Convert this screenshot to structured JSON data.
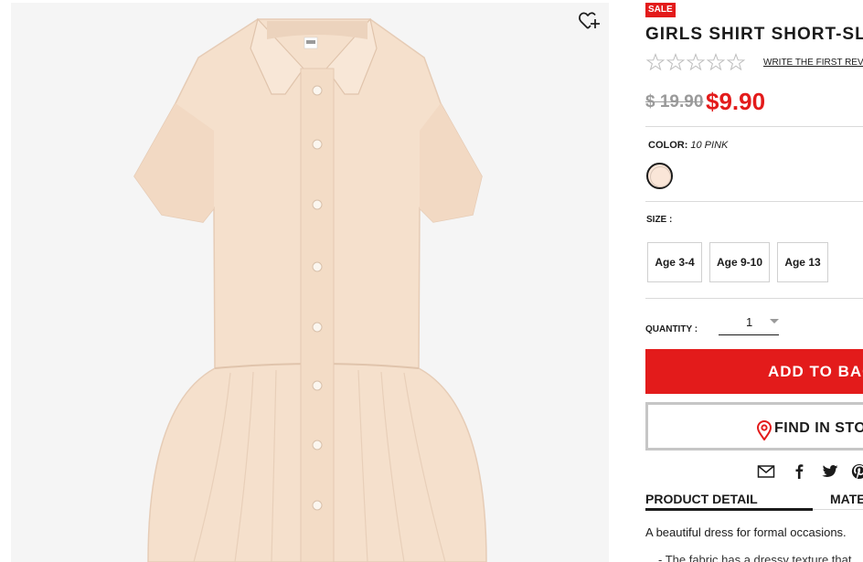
{
  "product": {
    "sale_badge": "SALE",
    "title": "GIRLS SHIRT SHORT-SLE",
    "review_link": "WRITE THE FIRST REVIE",
    "price_original": "$ 19.90",
    "price_sale": "$9.90",
    "rating_stars": 0
  },
  "color": {
    "label": "COLOR:",
    "value": "10 PINK",
    "swatch": "#fae6d8"
  },
  "size": {
    "label": "SIZE :",
    "options": [
      "Age 3-4",
      "Age 9-10",
      "Age 13"
    ]
  },
  "quantity": {
    "label": "QUANTITY :",
    "value": "1"
  },
  "actions": {
    "add_to_bag": "ADD TO BAG",
    "find_in_store": "FIND IN STOR"
  },
  "share_icons": [
    "mail-icon",
    "facebook-icon",
    "twitter-icon",
    "pinterest-icon"
  ],
  "tabs": [
    "PRODUCT DETAIL",
    "MATE"
  ],
  "details": {
    "description": "A beautiful dress for formal occasions.",
    "bullet": "- The fabric has a dressy texture that"
  },
  "colors": {
    "sale_red": "#e31b1b",
    "text": "#1b1b1b",
    "muted": "#9a9a9a",
    "dress": "#f5e0cc"
  }
}
